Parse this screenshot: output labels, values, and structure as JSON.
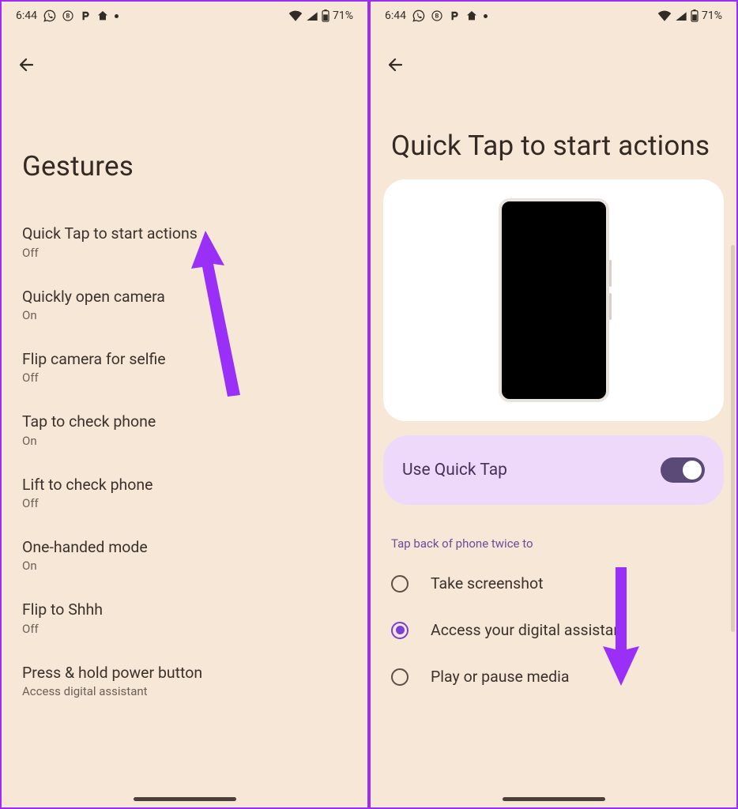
{
  "status": {
    "time": "6:44",
    "battery": "71%"
  },
  "left": {
    "title": "Gestures",
    "items": [
      {
        "title": "Quick Tap to start actions",
        "sub": "Off"
      },
      {
        "title": "Quickly open camera",
        "sub": "On"
      },
      {
        "title": "Flip camera for selfie",
        "sub": "Off"
      },
      {
        "title": "Tap to check phone",
        "sub": "On"
      },
      {
        "title": "Lift to check phone",
        "sub": "Off"
      },
      {
        "title": "One-handed mode",
        "sub": "On"
      },
      {
        "title": "Flip to Shhh",
        "sub": "Off"
      },
      {
        "title": "Press & hold power button",
        "sub": "Access digital assistant"
      }
    ]
  },
  "right": {
    "title": "Quick Tap to start actions",
    "toggle": {
      "label": "Use Quick Tap",
      "on": true
    },
    "section": "Tap back of phone twice to",
    "options": [
      {
        "label": "Take screenshot",
        "selected": false
      },
      {
        "label": "Access your digital assistant",
        "selected": true
      },
      {
        "label": "Play or pause media",
        "selected": false
      }
    ]
  },
  "colors": {
    "accent": "#9a30f7",
    "bg": "#f6e7d7",
    "togglecard": "#efd9fb",
    "switch": "#5b4a78",
    "radio": "#7a3fd9"
  }
}
